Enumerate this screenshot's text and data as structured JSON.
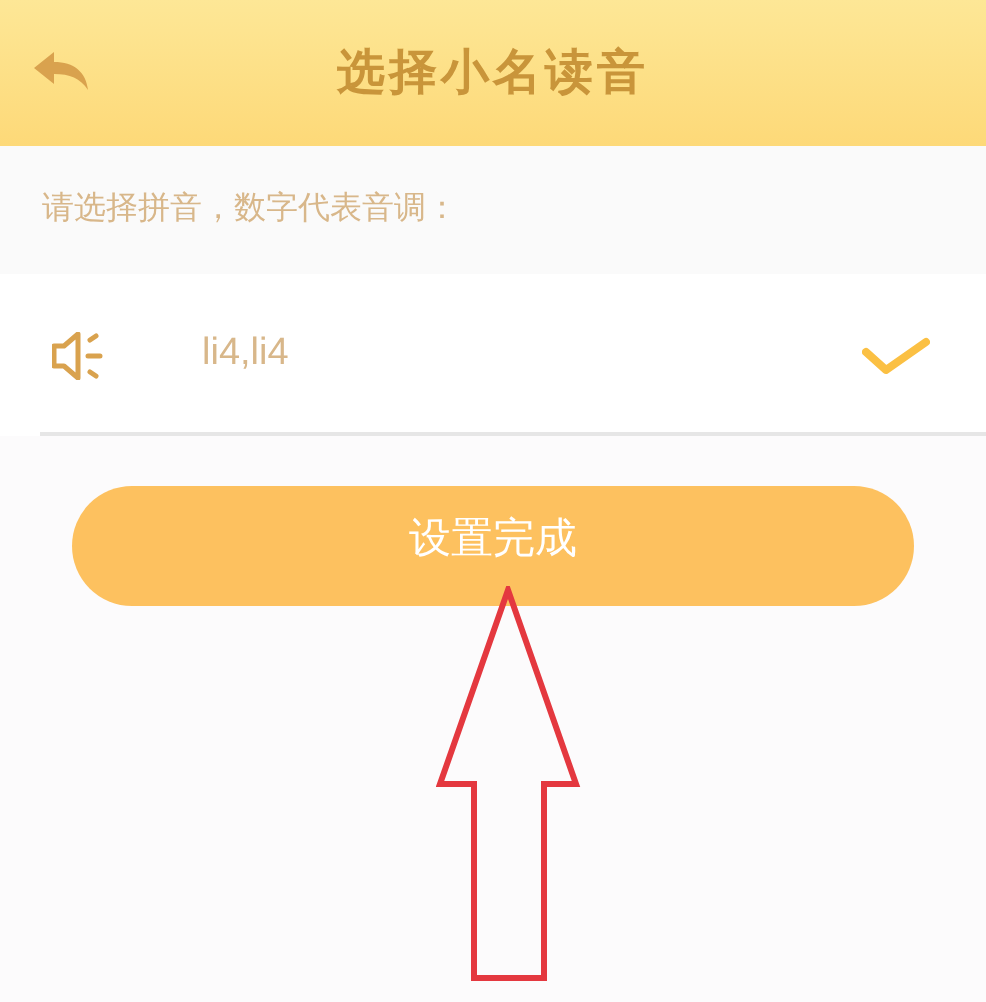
{
  "header": {
    "title": "选择小名读音"
  },
  "instruction": "请选择拼音，数字代表音调：",
  "options": [
    {
      "pinyin": "li4,li4",
      "selected": true
    }
  ],
  "button": {
    "label": "设置完成"
  },
  "annotation": {
    "kind": "arrow"
  }
}
